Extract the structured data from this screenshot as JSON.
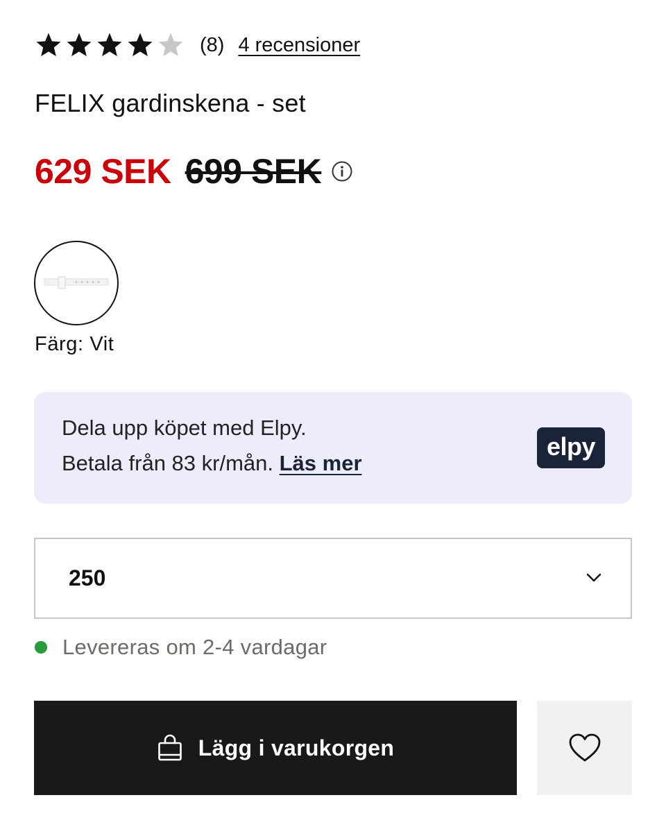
{
  "rating": {
    "stars_filled": 4,
    "stars_total": 5,
    "count_label": "(8)",
    "reviews_link": "4 recensioner",
    "filled_color": "#111111",
    "empty_color": "#c8c8c8"
  },
  "product": {
    "title": "FELIX gardinskena - set"
  },
  "price": {
    "current": "629 SEK",
    "original": "699 SEK",
    "current_color": "#cc0008",
    "info_icon": "info-icon"
  },
  "color": {
    "label": "Färg: Vit",
    "swatch_icon": "curtain-rail-thumbnail"
  },
  "financing": {
    "line1": "Dela upp köpet med Elpy.",
    "line2": "Betala från 83 kr/mån.",
    "link": "Läs mer",
    "logo_text": "elpy",
    "background": "#ececfb",
    "logo_color": "#1b2338"
  },
  "size_select": {
    "selected": "250",
    "icon": "chevron-down-icon"
  },
  "delivery": {
    "status_text": "Levereras om 2-4 vardagar",
    "status_color": "#2c9a3c"
  },
  "actions": {
    "add_to_cart": "Lägg i varukorgen",
    "add_to_cart_icon": "shopping-bag-icon",
    "wishlist_icon": "heart-icon"
  }
}
